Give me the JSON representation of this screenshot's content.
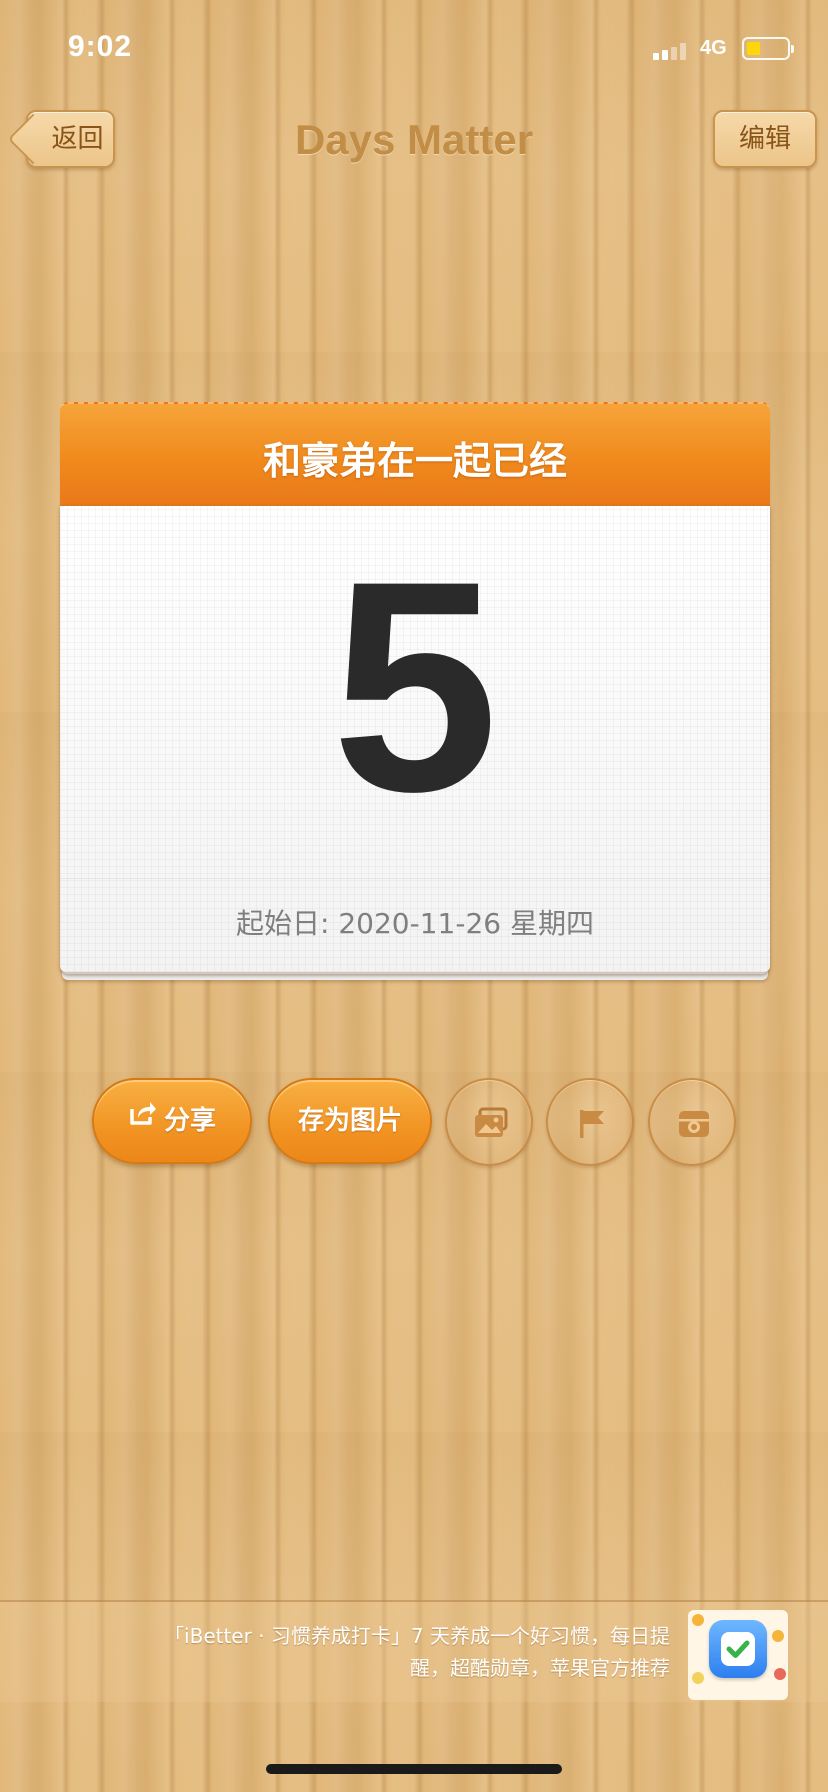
{
  "status_bar": {
    "time": "9:02",
    "network": "4G",
    "battery_color": "#ffd60a",
    "signal_bars_filled": 2,
    "signal_bars_total": 4
  },
  "nav": {
    "back_label": "返回",
    "title": "Days Matter",
    "edit_label": "编辑"
  },
  "event_card": {
    "title": "和豪弟在一起已经",
    "day_count": "5",
    "start_date": "起始日: 2020-11-26 星期四",
    "header_color": "#f08a1c"
  },
  "actions": {
    "share_label": "分享",
    "save_image_label": "存为图片",
    "icons": [
      "gallery-icon",
      "flag-icon",
      "camera-icon"
    ]
  },
  "ad": {
    "line1": "「iBetter · 习惯养成打卡」7 天养成一个好习惯，每日提",
    "line2": "醒，超酷勋章，苹果官方推荐"
  }
}
